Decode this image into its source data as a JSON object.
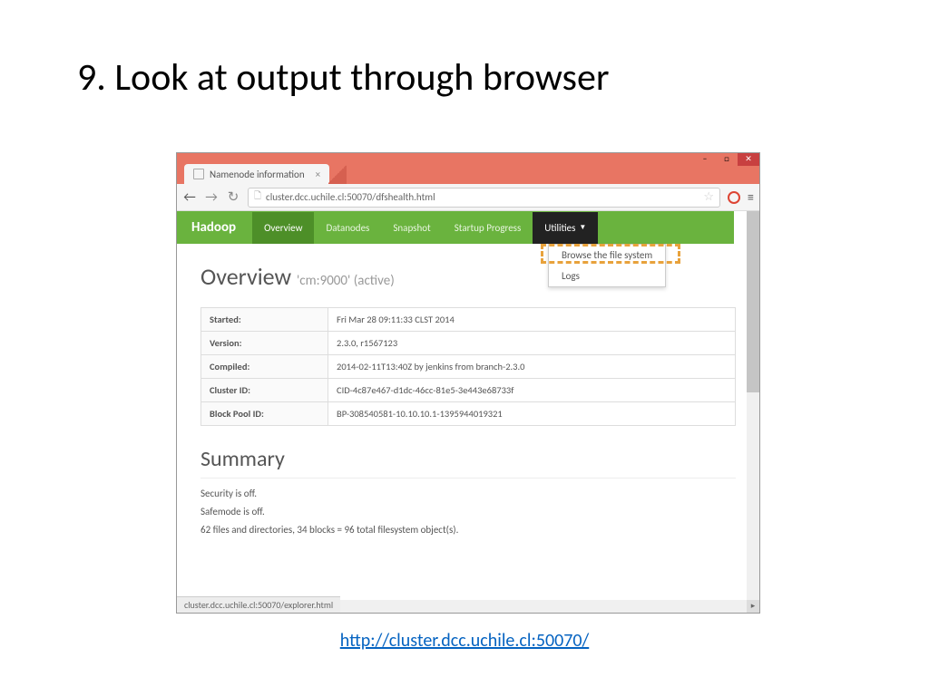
{
  "slide": {
    "title": "9. Look at output through browser",
    "link": "http://cluster.dcc.uchile.cl:50070/"
  },
  "browser": {
    "tab_title": "Namenode information",
    "url": "cluster.dcc.uchile.cl:50070/dfshealth.html",
    "status_text": "cluster.dcc.uchile.cl:50070/explorer.html"
  },
  "nav": {
    "brand": "Hadoop",
    "items": [
      "Overview",
      "Datanodes",
      "Snapshot",
      "Startup Progress"
    ],
    "utilities": "Utilities",
    "dropdown": [
      "Browse the file system",
      "Logs"
    ]
  },
  "overview": {
    "heading": "Overview",
    "sub": "'cm:9000' (active)",
    "rows": [
      {
        "k": "Started:",
        "v": "Fri Mar 28 09:11:33 CLST 2014"
      },
      {
        "k": "Version:",
        "v": "2.3.0, r1567123"
      },
      {
        "k": "Compiled:",
        "v": "2014-02-11T13:40Z by jenkins from branch-2.3.0"
      },
      {
        "k": "Cluster ID:",
        "v": "CID-4c87e467-d1dc-46cc-81e5-3e443e68733f"
      },
      {
        "k": "Block Pool ID:",
        "v": "BP-308540581-10.10.10.1-1395944019321"
      }
    ]
  },
  "summary": {
    "heading": "Summary",
    "lines": [
      "Security is off.",
      "Safemode is off.",
      "62 files and directories, 34 blocks = 96 total filesystem object(s)."
    ]
  }
}
